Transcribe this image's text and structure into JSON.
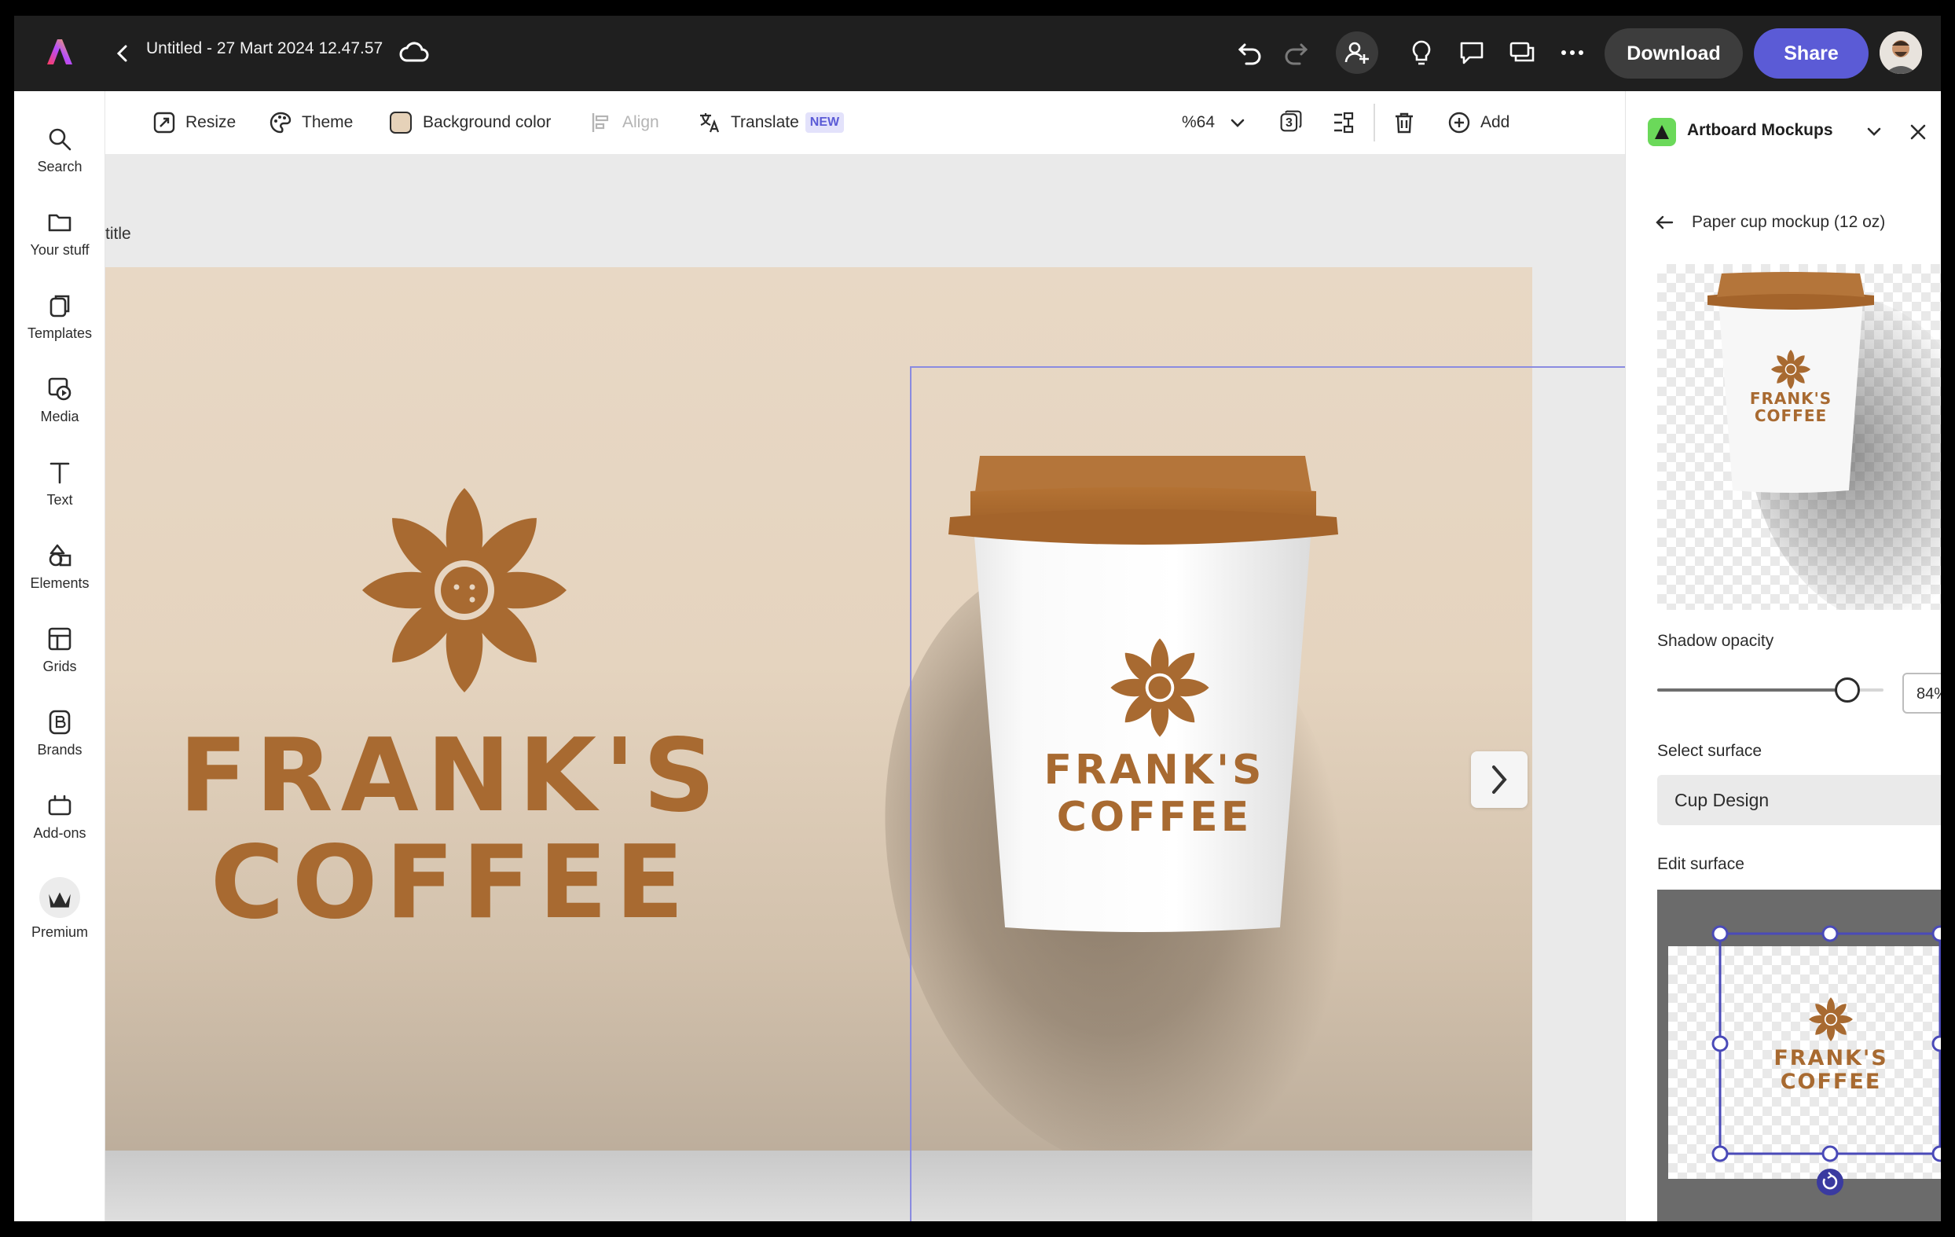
{
  "topbar": {
    "doc_title": "Untitled - 27 Mart 2024 12.47.57",
    "download_label": "Download",
    "share_label": "Share"
  },
  "leftrail": {
    "items": [
      {
        "label": "Search",
        "icon": "search-icon"
      },
      {
        "label": "Your stuff",
        "icon": "folder-icon"
      },
      {
        "label": "Templates",
        "icon": "templates-icon"
      },
      {
        "label": "Media",
        "icon": "media-icon"
      },
      {
        "label": "Text",
        "icon": "text-icon"
      },
      {
        "label": "Elements",
        "icon": "elements-icon"
      },
      {
        "label": "Grids",
        "icon": "grids-icon"
      },
      {
        "label": "Brands",
        "icon": "brands-icon"
      },
      {
        "label": "Add-ons",
        "icon": "addons-icon"
      },
      {
        "label": "Premium",
        "icon": "premium-crown-icon"
      }
    ]
  },
  "toolbar": {
    "resize_label": "Resize",
    "theme_label": "Theme",
    "background_label": "Background color",
    "background_swatch": "#e6d2b9",
    "align_label": "Align",
    "translate_label": "Translate",
    "translate_badge": "NEW",
    "zoom_label": "%64",
    "layers_count": "3",
    "add_label": "Add"
  },
  "canvas": {
    "page_label": "title",
    "brand_line1": "FRANK'S",
    "brand_line2": "COFFEE",
    "brand_color": "#a86a31",
    "cup_text_line1": "FRANK'S",
    "cup_text_line2": "COFFEE"
  },
  "panel": {
    "title": "Artboard Mockups",
    "subtitle": "Paper cup mockup (12 oz)",
    "preview_text_line1": "FRANK'S",
    "preview_text_line2": "COFFEE",
    "shadow_label": "Shadow opacity",
    "shadow_value": "84%",
    "shadow_fraction": 0.84,
    "surface_label": "Select surface",
    "surface_value": "Cup Design",
    "edit_label": "Edit surface",
    "edit_text_line1": "FRANK'S",
    "edit_text_line2": "COFFEE"
  },
  "colors": {
    "accent": "#5b5bd6",
    "topbar_bg": "#1f1f1f",
    "brand": "#a86a31"
  }
}
